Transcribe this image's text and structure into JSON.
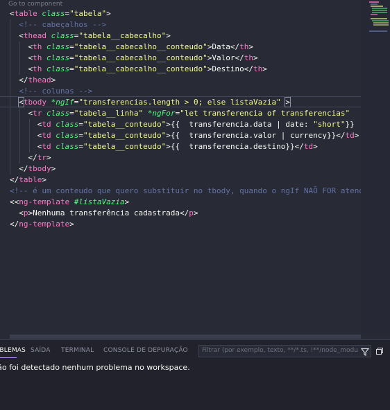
{
  "editor": {
    "codelens": "Go to component",
    "lines": [
      [
        [
          "<",
          "p"
        ],
        [
          "table ",
          "t"
        ],
        [
          "class",
          "a"
        ],
        [
          "=",
          "p"
        ],
        [
          "\"tabela\"",
          "s"
        ],
        [
          ">",
          "p"
        ]
      ],
      [
        [
          "  ",
          "p"
        ],
        [
          "<!-- cabeçalhos -->",
          "c"
        ]
      ],
      [
        [
          "  ",
          "p"
        ],
        [
          "<",
          "p"
        ],
        [
          "thead ",
          "t"
        ],
        [
          "class",
          "a"
        ],
        [
          "=",
          "p"
        ],
        [
          "\"tabela__cabecalho\"",
          "s"
        ],
        [
          ">",
          "p"
        ]
      ],
      [
        [
          "    ",
          "p"
        ],
        [
          "<",
          "p"
        ],
        [
          "th ",
          "t"
        ],
        [
          "class",
          "a"
        ],
        [
          "=",
          "p"
        ],
        [
          "\"tabela__cabecalho__conteudo\"",
          "s"
        ],
        [
          ">Data</",
          "p"
        ],
        [
          "th",
          "t"
        ],
        [
          ">",
          "p"
        ]
      ],
      [
        [
          "    ",
          "p"
        ],
        [
          "<",
          "p"
        ],
        [
          "th ",
          "t"
        ],
        [
          "class",
          "a"
        ],
        [
          "=",
          "p"
        ],
        [
          "\"tabela__cabecalho__conteudo\"",
          "s"
        ],
        [
          ">Valor</",
          "p"
        ],
        [
          "th",
          "t"
        ],
        [
          ">",
          "p"
        ]
      ],
      [
        [
          "    ",
          "p"
        ],
        [
          "<",
          "p"
        ],
        [
          "th ",
          "t"
        ],
        [
          "class",
          "a"
        ],
        [
          "=",
          "p"
        ],
        [
          "\"tabela__cabecalho__conteudo\"",
          "s"
        ],
        [
          ">Destino</",
          "p"
        ],
        [
          "th",
          "t"
        ],
        [
          ">",
          "p"
        ]
      ],
      [
        [
          "  ",
          "p"
        ],
        [
          "</",
          "p"
        ],
        [
          "thead",
          "t"
        ],
        [
          ">",
          "p"
        ]
      ],
      [
        [
          "  ",
          "p"
        ],
        [
          "<!-- colunas -->",
          "c"
        ]
      ],
      [
        [
          "  ",
          "p"
        ],
        [
          "<",
          "pb"
        ],
        [
          "tbody ",
          "t"
        ],
        [
          "*ngIf",
          "a"
        ],
        [
          "=",
          "p"
        ],
        [
          "\"transferencias.length > 0; else listaVazia\"",
          "s"
        ],
        [
          " ",
          "p"
        ],
        [
          ">",
          "pb"
        ]
      ],
      [
        [
          "    ",
          "p"
        ],
        [
          "<",
          "p"
        ],
        [
          "tr ",
          "t"
        ],
        [
          "class",
          "a"
        ],
        [
          "=",
          "p"
        ],
        [
          "\"tabela__linha\"",
          "s"
        ],
        [
          " ",
          "p"
        ],
        [
          "*ngFor",
          "a"
        ],
        [
          "=",
          "p"
        ],
        [
          "\"let transferencia of transferencias\"",
          "s"
        ]
      ],
      [
        [
          "      ",
          "p"
        ],
        [
          "<",
          "p"
        ],
        [
          "td ",
          "t"
        ],
        [
          "class",
          "a"
        ],
        [
          "=",
          "p"
        ],
        [
          "\"tabela__conteudo\"",
          "s"
        ],
        [
          ">{{",
          "p"
        ],
        [
          "  transferencia.data | date: ",
          "p"
        ],
        [
          "\"short\"",
          "s"
        ],
        [
          "}}",
          "p"
        ]
      ],
      [
        [
          "      ",
          "p"
        ],
        [
          "<",
          "p"
        ],
        [
          "td ",
          "t"
        ],
        [
          "class",
          "a"
        ],
        [
          "=",
          "p"
        ],
        [
          "\"tabela__conteudo\"",
          "s"
        ],
        [
          ">{{",
          "p"
        ],
        [
          "  transferencia.valor | currency",
          "p"
        ],
        [
          "}}",
          "p"
        ],
        [
          "</",
          "p"
        ],
        [
          "td",
          "t"
        ],
        [
          ">",
          "p"
        ]
      ],
      [
        [
          "      ",
          "p"
        ],
        [
          "<",
          "p"
        ],
        [
          "td ",
          "t"
        ],
        [
          "class",
          "a"
        ],
        [
          "=",
          "p"
        ],
        [
          "\"tabela__conteudo\"",
          "s"
        ],
        [
          ">{{",
          "p"
        ],
        [
          "  transferencia.destino",
          "p"
        ],
        [
          "}}",
          "p"
        ],
        [
          "</",
          "p"
        ],
        [
          "td",
          "t"
        ],
        [
          ">",
          "p"
        ]
      ],
      [
        [
          "    ",
          "p"
        ],
        [
          "</",
          "p"
        ],
        [
          "tr",
          "t"
        ],
        [
          ">",
          "p"
        ]
      ],
      [
        [
          "  ",
          "p"
        ],
        [
          "</",
          "p"
        ],
        [
          "tbody",
          "t"
        ],
        [
          ">",
          "p"
        ]
      ],
      [
        [
          "</",
          "p"
        ],
        [
          "table",
          "t"
        ],
        [
          ">",
          "p"
        ]
      ],
      [
        [
          "<!-- é um conteudo que quero substituir no tbody, quando o ngIf NAÕ FOR atendido -->",
          "c"
        ]
      ],
      [
        [
          "<",
          "p"
        ],
        [
          "<",
          "p"
        ],
        [
          "ng-template ",
          "t"
        ],
        [
          "#listaVazia",
          "a"
        ],
        [
          ">",
          "p"
        ]
      ],
      [
        [
          "  ",
          "p"
        ],
        [
          "<",
          "p"
        ],
        [
          "p",
          "t"
        ],
        [
          ">Nenhuma transferência cadastrada</",
          "p"
        ],
        [
          "p",
          "t"
        ],
        [
          ">",
          "p"
        ]
      ],
      [
        [
          "</",
          "p"
        ],
        [
          "ng-template",
          "t"
        ],
        [
          ">",
          "p"
        ]
      ]
    ]
  },
  "panel": {
    "tabs": [
      {
        "label": "PROBLEMAS",
        "active": true
      },
      {
        "label": "SAÍDA",
        "active": false
      },
      {
        "label": "TERMINAL",
        "active": false
      },
      {
        "label": "CONSOLE DE DEPURAÇÃO",
        "active": false
      }
    ],
    "filter_placeholder": "Filtrar (por exemplo, texto, **/*.ts, !**/node_modules/**)",
    "message": "Não foi detectado nenhum problema no workspace."
  },
  "colors": {
    "background": "#282a36",
    "tag": "#ff79c6",
    "attribute": "#50fa7b",
    "string": "#f1fa8c",
    "comment": "#6272a4",
    "text": "#f8f8f2",
    "panel_background": "#21222c"
  },
  "icons": [
    "filter-icon",
    "collapse-panel-icon"
  ]
}
